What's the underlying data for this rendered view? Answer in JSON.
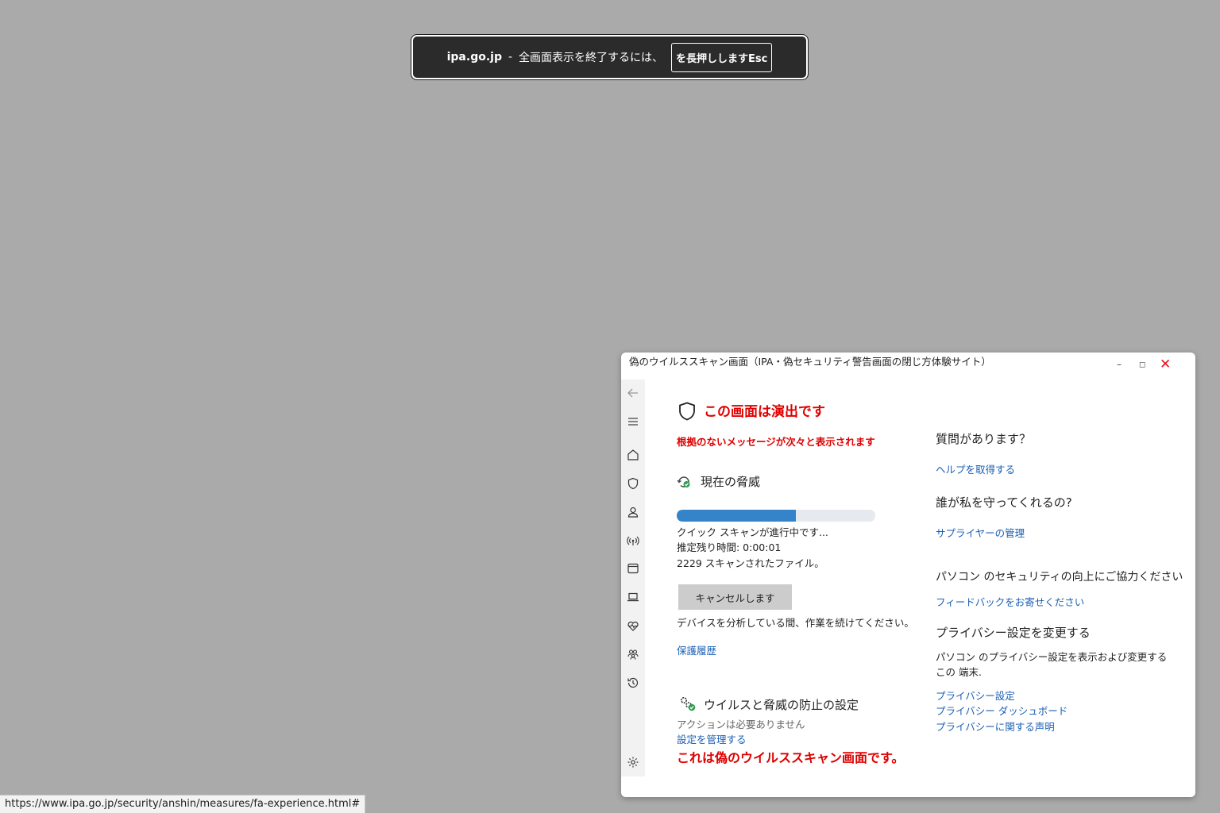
{
  "fullscreen_notice": {
    "domain": "ipa.go.jp",
    "separator": "-",
    "message": "全画面表示を終了するには、",
    "key_hint": "を長押ししますEsc"
  },
  "status_url": "https://www.ipa.go.jp/security/anshin/measures/fa-experience.html#",
  "window": {
    "title": "偽のウイルススキャン画面（IPA・偽セキュリティ警告画面の閉じ方体験サイト）",
    "minimize": "–",
    "maximize": "◻",
    "close": "✕"
  },
  "sidebar_icons": [
    "back-arrow-icon",
    "menu-icon",
    "home-icon",
    "shield-icon",
    "account-icon",
    "wireless-icon",
    "app-browser-icon",
    "laptop-icon",
    "health-icon",
    "family-icon",
    "history-icon",
    "settings-icon"
  ],
  "main": {
    "heading": "この画面は演出です",
    "subheading": "根拠のないメッセージが次々と表示されます",
    "threat_heading": "現在の脅威",
    "progress_percent": 60,
    "scan_status": "クイック スキャンが進行中です...",
    "time_remaining": "推定残り時間: 0:00:01",
    "files_scanned": "2229 スキャンされたファイル。",
    "cancel_label": "キャンセルします",
    "continue_note": "デバイスを分析している間、作業を続けてください。",
    "history_link": "保護履歴",
    "settings_heading": "ウイルスと脅威の防止の設定",
    "no_action": "アクションは必要ありません",
    "manage_link": "設定を管理する",
    "fake_notice": "これは偽のウイルススキャン画面です。"
  },
  "right": {
    "question_heading": "質問があります？",
    "help_link": "ヘルプを取得する",
    "protect_heading": "誰が私を守ってくれるの?",
    "provider_link": "サプライヤーの管理",
    "feedback_heading": "パソコン のセキュリティの向上にご協力ください",
    "feedback_link": "フィードバックをお寄せください",
    "privacy_heading": "プライバシー設定を変更する",
    "privacy_desc_1": "パソコン のプライバシー設定を表示および変更する",
    "privacy_desc_2": "この 端末.",
    "privacy_links": [
      "プライバシー設定",
      "プライバシー ダッシュボード",
      "プライバシーに関する声明"
    ]
  },
  "colors": {
    "alert_red": "#e00000",
    "link_blue": "#1a5fb4",
    "progress_blue": "#3584c9",
    "backdrop_gray": "#aaaaaa"
  }
}
